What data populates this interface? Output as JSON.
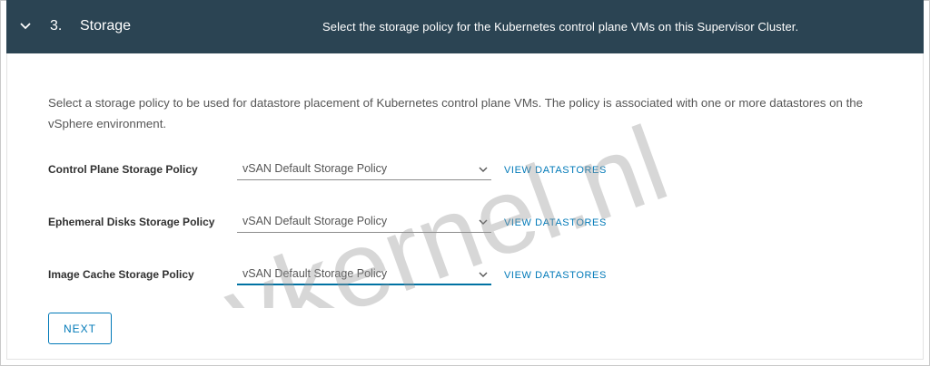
{
  "header": {
    "step_number": "3.",
    "step_name": "Storage",
    "description": "Select the storage policy for the Kubernetes control plane VMs on this Supervisor Cluster."
  },
  "intro_text": "Select a storage policy to be used for datastore placement of Kubernetes control plane VMs. The policy is associated with one or more datastores on the vSphere environment.",
  "policies": [
    {
      "label": "Control Plane Storage Policy",
      "value": "vSAN Default Storage Policy",
      "link": "VIEW DATASTORES"
    },
    {
      "label": "Ephemeral Disks Storage Policy",
      "value": "vSAN Default Storage Policy",
      "link": "VIEW DATASTORES"
    },
    {
      "label": "Image Cache Storage Policy",
      "value": "vSAN Default Storage Policy",
      "link": "VIEW DATASTORES"
    }
  ],
  "next_label": "NEXT",
  "watermark": "vkernel.nl",
  "colors": {
    "header_bg": "#2b4453",
    "link": "#0079b8",
    "active_underline": "#0072a3"
  },
  "icons": {
    "collapse": "chevron-down-icon",
    "dropdown": "caret-down-icon"
  }
}
